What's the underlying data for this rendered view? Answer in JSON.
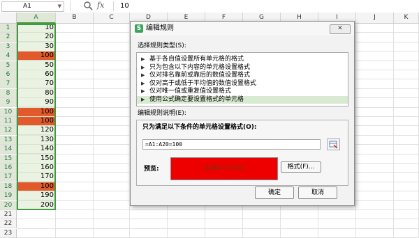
{
  "formula_bar": {
    "name_box": "A1",
    "fx_label": "fx",
    "value": "10"
  },
  "sheet": {
    "columns": [
      "A",
      "B",
      "C",
      "D",
      "E",
      "F",
      "G",
      "H",
      "I",
      "J",
      "K"
    ],
    "rows": [
      "1",
      "2",
      "3",
      "4",
      "5",
      "6",
      "7",
      "8",
      "9",
      "10",
      "11",
      "12",
      "13",
      "14",
      "15",
      "16",
      "17",
      "18",
      "19",
      "20",
      "21",
      "22",
      "23"
    ],
    "column_a_values": [
      "10",
      "20",
      "30",
      "100",
      "50",
      "60",
      "70",
      "80",
      "90",
      "100",
      "100",
      "120",
      "130",
      "140",
      "150",
      "160",
      "170",
      "100",
      "190",
      "200"
    ],
    "highlight_rows": [
      4,
      10,
      11,
      18
    ],
    "colors": {
      "highlight": "#e05a2b",
      "selection": "#3f9b3f",
      "selection_fill": "#eaf3e2"
    }
  },
  "dialog": {
    "title": "编辑规则",
    "close_label": "✕",
    "rule_type_label": "选择规则类型(S):",
    "rule_types": [
      "基于各自值设置所有单元格的格式",
      "只为包含以下内容的单元格设置格式",
      "仅对排名靠前或靠后的数值设置格式",
      "仅对高于或低于平均值的数值设置格式",
      "仅对唯一值或重复值设置格式",
      "使用公式确定要设置格式的单元格"
    ],
    "selected_rule_index": 5,
    "description_label": "编辑规则说明(E):",
    "formula_title": "只为满足以下条件的单元格设置格式(O):",
    "formula": "=A1:A20=100",
    "preview_label": "预览:",
    "preview_text": "AaBbCcYyZz",
    "preview_color": "#ee0000",
    "format_button": "格式(F)...",
    "ok_button": "确定",
    "cancel_button": "取消"
  }
}
